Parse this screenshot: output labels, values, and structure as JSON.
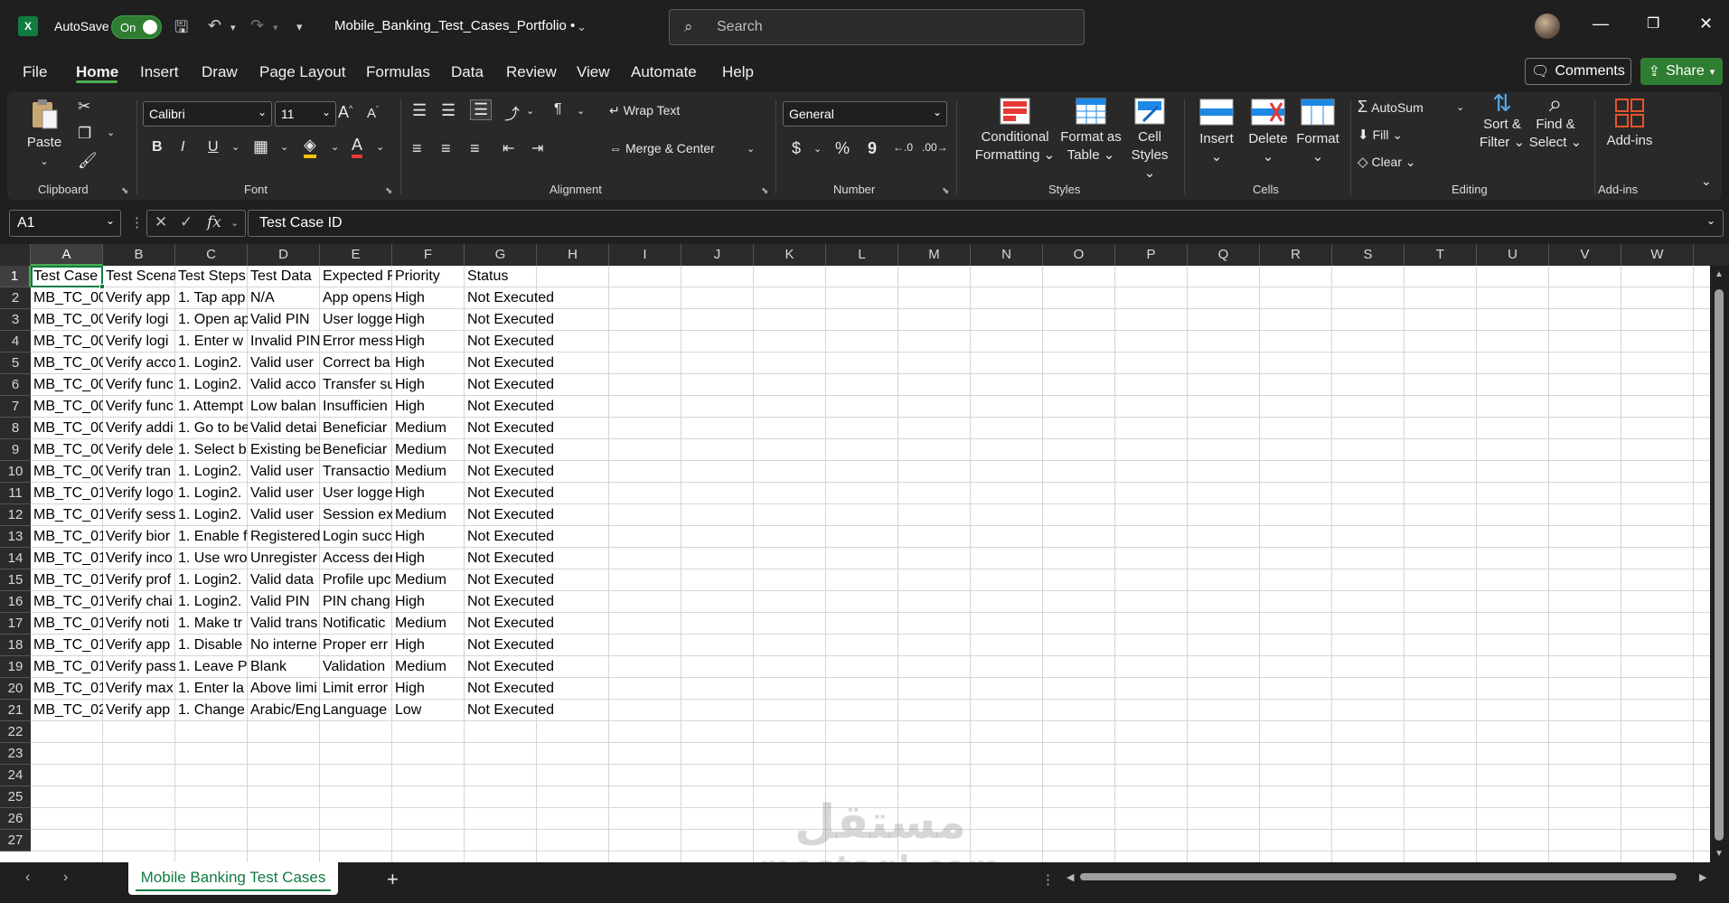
{
  "titlebar": {
    "autosave_label": "AutoSave",
    "autosave_state": "On",
    "document_title": "Mobile_Banking_Test_Cases_Portfolio •",
    "search_placeholder": "Search"
  },
  "tabs": [
    "File",
    "Home",
    "Insert",
    "Draw",
    "Page Layout",
    "Formulas",
    "Data",
    "Review",
    "View",
    "Automate",
    "Help"
  ],
  "active_tab": "Home",
  "actions": {
    "comments": "Comments",
    "share": "Share"
  },
  "ribbon": {
    "clipboard": {
      "label": "Clipboard",
      "paste": "Paste"
    },
    "font": {
      "label": "Font",
      "family": "Calibri",
      "size": "11",
      "bold": "B",
      "italic": "I",
      "underline": "U"
    },
    "alignment": {
      "label": "Alignment",
      "wrap_text": "Wrap Text",
      "merge_center": "Merge & Center"
    },
    "number": {
      "label": "Number",
      "format": "General",
      "currency": "$",
      "percent": "%",
      "comma": "9"
    },
    "styles": {
      "label": "Styles",
      "conditional": [
        "Conditional",
        "Formatting"
      ],
      "format_table": [
        "Format as",
        "Table"
      ],
      "cell_styles": [
        "Cell",
        "Styles"
      ]
    },
    "cells": {
      "label": "Cells",
      "insert": "Insert",
      "delete": "Delete",
      "format": "Format"
    },
    "editing": {
      "label": "Editing",
      "autosum": "AutoSum",
      "fill": "Fill",
      "clear": "Clear",
      "sort_filter": [
        "Sort &",
        "Filter"
      ],
      "find_select": [
        "Find &",
        "Select"
      ]
    },
    "addins": {
      "label": "Add-ins",
      "addins": "Add-ins"
    }
  },
  "formula_bar": {
    "name_box": "A1",
    "fx": "fx",
    "content": "Test Case ID"
  },
  "columns": [
    "A",
    "B",
    "C",
    "D",
    "E",
    "F",
    "G",
    "H",
    "I",
    "J",
    "K",
    "L",
    "M",
    "N",
    "O",
    "P",
    "Q",
    "R",
    "S",
    "T",
    "U",
    "V",
    "W"
  ],
  "rows": [
    [
      "Test Case",
      "Test Scena",
      "Test Steps",
      "Test Data",
      "Expected F",
      "Priority",
      "Status"
    ],
    [
      "MB_TC_00",
      "Verify app",
      "1. Tap app",
      "N/A",
      "App opens",
      "High",
      "Not Executed"
    ],
    [
      "MB_TC_00",
      "Verify logi",
      "1. Open ap",
      "Valid PIN",
      "User logge",
      "High",
      "Not Executed"
    ],
    [
      "MB_TC_00",
      "Verify logi",
      "1. Enter w",
      "Invalid PIN",
      "Error mess",
      "High",
      "Not Executed"
    ],
    [
      "MB_TC_00",
      "Verify acco",
      "1. Login2.",
      "Valid user",
      "Correct ba",
      "High",
      "Not Executed"
    ],
    [
      "MB_TC_00",
      "Verify func",
      "1. Login2.",
      "Valid acco",
      "Transfer su",
      "High",
      "Not Executed"
    ],
    [
      "MB_TC_00",
      "Verify func",
      "1. Attempt",
      "Low balan",
      "Insufficien",
      "High",
      "Not Executed"
    ],
    [
      "MB_TC_00",
      "Verify addi",
      "1. Go to be",
      "Valid detai",
      "Beneficiar",
      "Medium",
      "Not Executed"
    ],
    [
      "MB_TC_00",
      "Verify dele",
      "1. Select b",
      "Existing be",
      "Beneficiar",
      "Medium",
      "Not Executed"
    ],
    [
      "MB_TC_00",
      "Verify tran",
      "1. Login2.",
      "Valid user",
      "Transactio",
      "Medium",
      "Not Executed"
    ],
    [
      "MB_TC_01",
      "Verify logo",
      "1. Login2.",
      "Valid user",
      "User logge",
      "High",
      "Not Executed"
    ],
    [
      "MB_TC_01",
      "Verify sess",
      "1. Login2.",
      "Valid user",
      "Session ex",
      "Medium",
      "Not Executed"
    ],
    [
      "MB_TC_01",
      "Verify bior",
      "1. Enable f",
      "Registered",
      "Login succ",
      "High",
      "Not Executed"
    ],
    [
      "MB_TC_01",
      "Verify inco",
      "1. Use wro",
      "Unregister",
      "Access der",
      "High",
      "Not Executed"
    ],
    [
      "MB_TC_01",
      "Verify prof",
      "1. Login2.",
      "Valid data",
      "Profile upc",
      "Medium",
      "Not Executed"
    ],
    [
      "MB_TC_01",
      "Verify chai",
      "1. Login2.",
      "Valid PIN",
      "PIN chang",
      "High",
      "Not Executed"
    ],
    [
      "MB_TC_01",
      "Verify noti",
      "1. Make tr",
      "Valid trans",
      "Notificatic",
      "Medium",
      "Not Executed"
    ],
    [
      "MB_TC_01",
      "Verify app",
      "1. Disable",
      "No interne",
      "Proper err",
      "High",
      "Not Executed"
    ],
    [
      "MB_TC_01",
      "Verify pass",
      "1. Leave P",
      "Blank",
      "Validation",
      "Medium",
      "Not Executed"
    ],
    [
      "MB_TC_01",
      "Verify max",
      "1. Enter la",
      "Above limi",
      "Limit error",
      "High",
      "Not Executed"
    ],
    [
      "MB_TC_02",
      "Verify app",
      "1. Change",
      "Arabic/Eng",
      "Language",
      "Low",
      "Not Executed"
    ]
  ],
  "row_numbers": [
    "1",
    "2",
    "3",
    "4",
    "5",
    "6",
    "7",
    "8",
    "9",
    "10",
    "11",
    "12",
    "13",
    "14",
    "15",
    "16",
    "17",
    "18",
    "19",
    "20",
    "21",
    "22",
    "23",
    "24",
    "25",
    "26",
    "27"
  ],
  "sheet": {
    "tab_name": "Mobile Banking Test Cases",
    "add": "+"
  },
  "watermark": {
    "arabic": "مستقل",
    "latin": "mostaql.com"
  },
  "colors": {
    "accent": "#107c41",
    "share": "#2e7d32"
  }
}
